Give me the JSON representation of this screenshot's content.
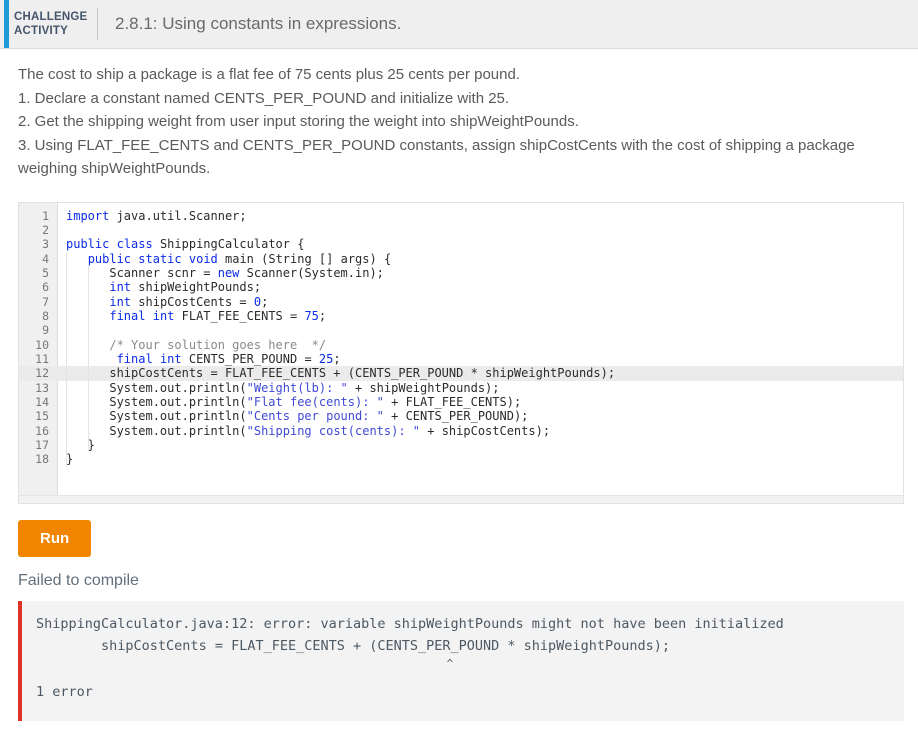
{
  "header": {
    "label_line1": "CHALLENGE",
    "label_line2": "ACTIVITY",
    "title": "2.8.1: Using constants in expressions.",
    "accent_color": "#1f9bd8",
    "background": "#efefef"
  },
  "prompt": {
    "line1": "The cost to ship a package is a flat fee of 75 cents plus 25 cents per pound.",
    "line2": "1. Declare a constant named CENTS_PER_POUND and initialize with 25.",
    "line3": "2. Get the shipping weight from user input storing the weight into shipWeightPounds.",
    "line4": "3. Using FLAT_FEE_CENTS and CENTS_PER_POUND constants, assign shipCostCents with the cost of shipping a package weighing shipWeightPounds."
  },
  "editor": {
    "active_line": 12,
    "lines": [
      {
        "n": "1",
        "text": "import java.util.Scanner;"
      },
      {
        "n": "2",
        "text": ""
      },
      {
        "n": "3",
        "text": "public class ShippingCalculator {"
      },
      {
        "n": "4",
        "text": "   public static void main (String [] args) {"
      },
      {
        "n": "5",
        "text": "      Scanner scnr = new Scanner(System.in);"
      },
      {
        "n": "6",
        "text": "      int shipWeightPounds;"
      },
      {
        "n": "7",
        "text": "      int shipCostCents = 0;"
      },
      {
        "n": "8",
        "text": "      final int FLAT_FEE_CENTS = 75;"
      },
      {
        "n": "9",
        "text": ""
      },
      {
        "n": "10",
        "text": "      /* Your solution goes here  */"
      },
      {
        "n": "11",
        "text": "       final int CENTS_PER_POUND = 25;"
      },
      {
        "n": "12",
        "text": "      shipCostCents = FLAT_FEE_CENTS + (CENTS_PER_POUND * shipWeightPounds);"
      },
      {
        "n": "13",
        "text": "      System.out.println(\"Weight(lb): \" + shipWeightPounds);"
      },
      {
        "n": "14",
        "text": "      System.out.println(\"Flat fee(cents): \" + FLAT_FEE_CENTS);"
      },
      {
        "n": "15",
        "text": "      System.out.println(\"Cents per pound: \" + CENTS_PER_POUND);"
      },
      {
        "n": "16",
        "text": "      System.out.println(\"Shipping cost(cents): \" + shipCostCents);"
      },
      {
        "n": "17",
        "text": "   }"
      },
      {
        "n": "18",
        "text": "}"
      }
    ]
  },
  "actions": {
    "run_label": "Run",
    "run_color": "#f28500"
  },
  "result": {
    "status": "Failed to compile",
    "error_line1": "ShippingCalculator.java:12: error: variable shipWeightPounds might not have been initialized",
    "error_line2": "        shipCostCents = FLAT_FEE_CENTS + (CENTS_PER_POUND * shipWeightPounds);",
    "error_caret": "                                                              ^",
    "error_summary": "1 error",
    "accent_color": "#e03127"
  }
}
